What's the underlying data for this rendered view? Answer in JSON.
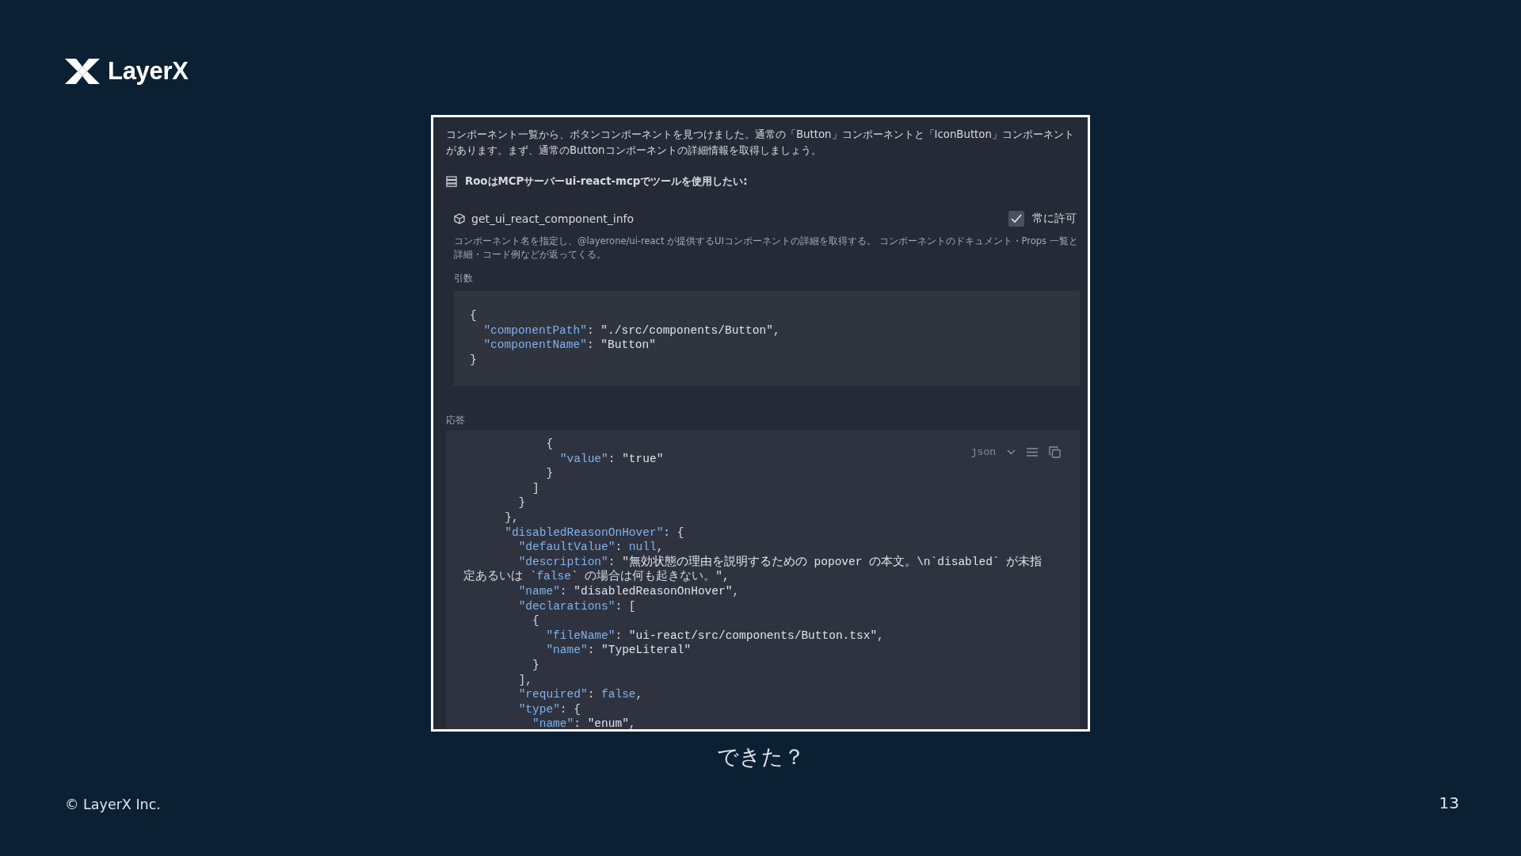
{
  "logo": {
    "text": "LayerX"
  },
  "screenshot": {
    "message": "コンポーネント一覧から、ボタンコンポーネントを見つけました。通常の「Button」コンポーネントと「IconButton」コンポーネントがあります。まず、通常のButtonコンポーネントの詳細情報を取得しましょう。",
    "tool_request": "RooはMCPサーバーui-react-mcpでツールを使用したい:",
    "tool": {
      "name": "get_ui_react_component_info",
      "always_allow": {
        "label": "常に許可",
        "checked": true
      },
      "description": "コンポーネント名を指定し、@layerone/ui-react が提供するUIコンポーネントの詳細を取得する。 コンポーネントのドキュメント・Props 一覧と詳細・コード例などが返ってくる。",
      "arguments_label": "引数",
      "arguments_lines": [
        "{",
        "  \"componentPath\": \"./src/components/Button\",",
        "  \"componentName\": \"Button\"",
        "}"
      ]
    },
    "response_label": "応答",
    "response": {
      "language": "json",
      "lines": [
        "            {",
        "              \"value\": \"true\"",
        "            }",
        "          ]",
        "        }",
        "      },",
        "      \"disabledReasonOnHover\": {",
        "        \"defaultValue\": null,",
        "        \"description\": \"無効状態の理由を説明するための popover の本文。\\n`disabled` が未指",
        "定あるいは `false` の場合は何も起きない。\",",
        "        \"name\": \"disabledReasonOnHover\",",
        "        \"declarations\": [",
        "          {",
        "            \"fileName\": \"ui-react/src/components/Button.tsx\",",
        "            \"name\": \"TypeLiteral\"",
        "          }",
        "        ],",
        "        \"required\": false,",
        "        \"type\": {",
        "          \"name\": \"enum\","
      ]
    }
  },
  "caption": "できた？",
  "copyright": "© LayerX Inc.",
  "page_number": "13"
}
